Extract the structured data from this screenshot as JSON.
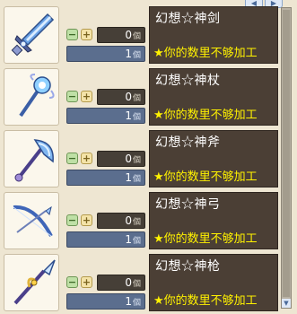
{
  "nav": {
    "prev_icon": "chevron-left-icon",
    "next_icon": "chevron-right-icon"
  },
  "unit": "個",
  "items": [
    {
      "name": "幻想☆神剑",
      "qty": "0",
      "owned": "1",
      "warning": "★你的数里不够加工",
      "icon": "sword-icon"
    },
    {
      "name": "幻想☆神杖",
      "qty": "0",
      "owned": "1",
      "warning": "★你的数里不够加工",
      "icon": "staff-icon"
    },
    {
      "name": "幻想☆神斧",
      "qty": "0",
      "owned": "1",
      "warning": "★你的数里不够加工",
      "icon": "axe-icon"
    },
    {
      "name": "幻想☆神弓",
      "qty": "0",
      "owned": "1",
      "warning": "★你的数里不够加工",
      "icon": "bow-icon"
    },
    {
      "name": "幻想☆神枪",
      "qty": "0",
      "owned": "1",
      "warning": "★你的数里不够加工",
      "icon": "spear-icon"
    }
  ],
  "colors": {
    "warning": "#fff200",
    "name_panel": "#4b3f35",
    "qty_box": "#463f37",
    "owned_box": "#5b6e8e"
  }
}
